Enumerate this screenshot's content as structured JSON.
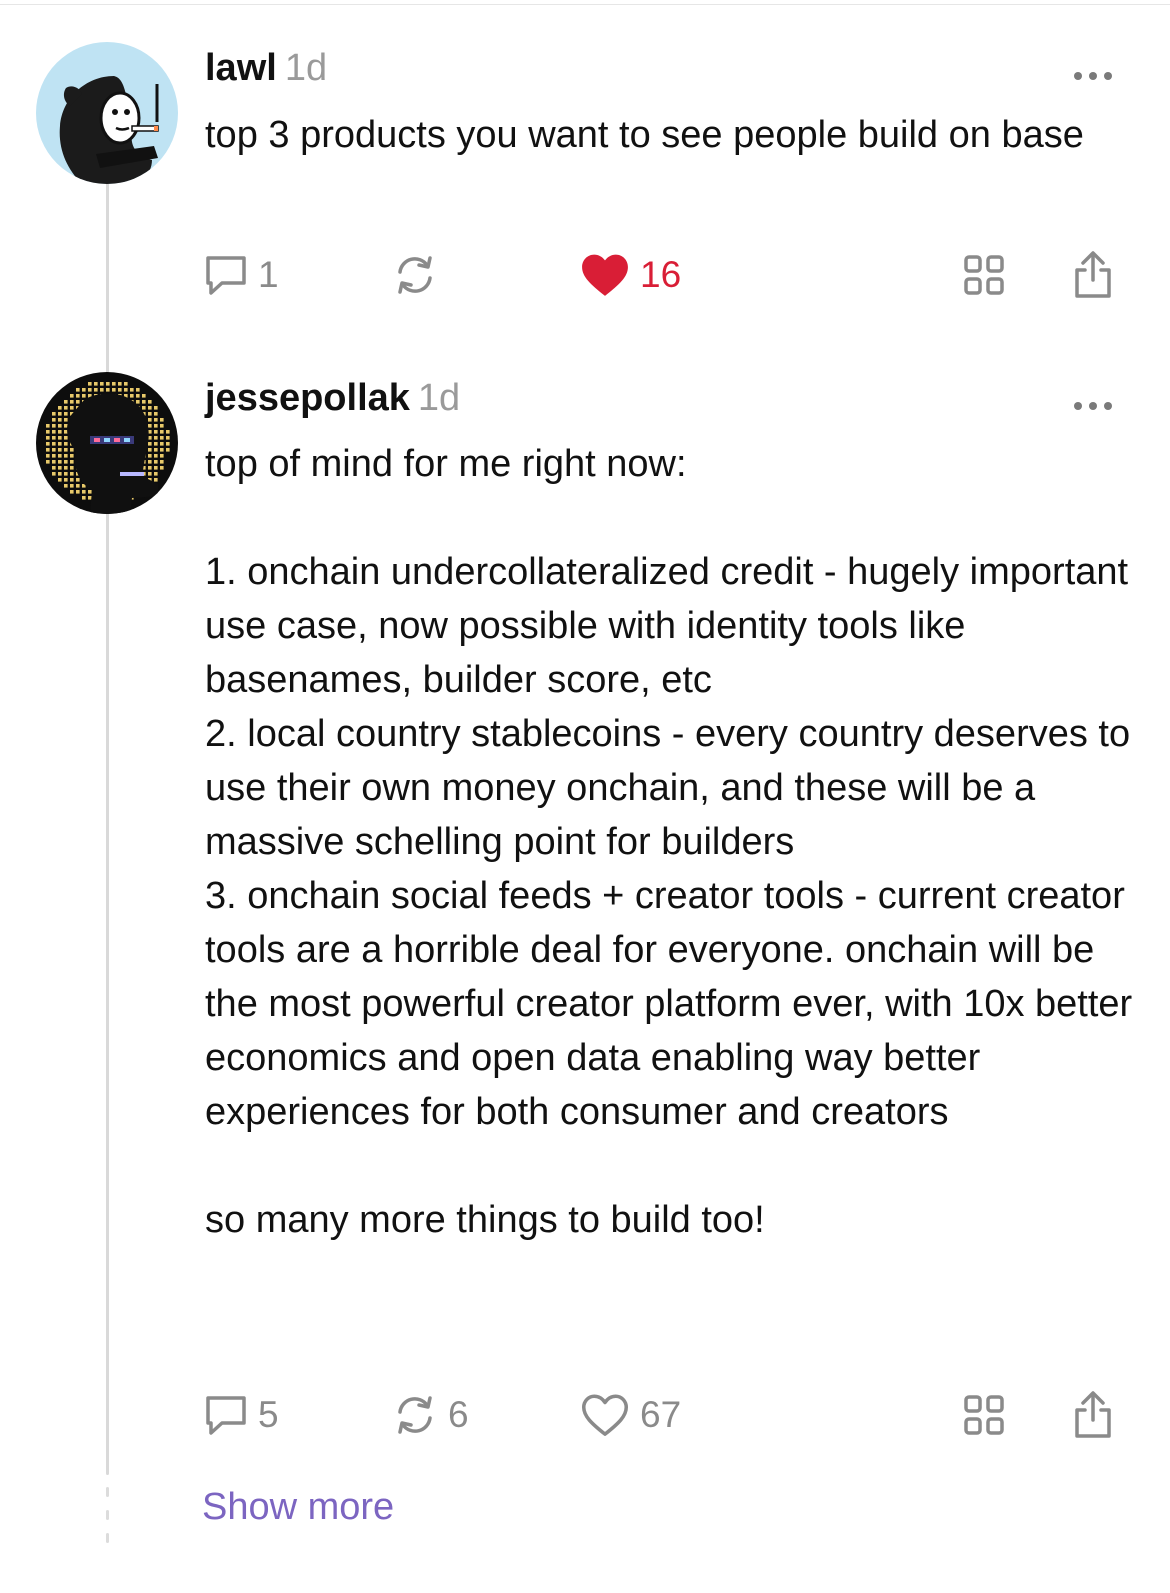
{
  "posts": [
    {
      "username": "lawl",
      "time": "1d",
      "text": "top 3 products you want to see people build on base",
      "avatar_icon": "smoking-hooded-figure-avatar",
      "actions": {
        "replies": "1",
        "recasts": "",
        "likes": "16",
        "liked": true
      }
    },
    {
      "username": "jessepollak",
      "time": "1d",
      "text": "top of mind for me right now:\n\n1. onchain undercollateralized credit - hugely important use case, now possible with identity tools like basenames, builder score, etc\n2. local country stablecoins - every country deserves to use their own money onchain, and these will be a massive schelling point for builders\n3. onchain social feeds + creator tools - current creator tools are a horrible deal for everyone. onchain will be the most powerful creator platform ever, with 10x better economics and open data enabling way better experiences for both consumer and creators\n\nso many more things to build too!",
      "avatar_icon": "pixel-art-avatar",
      "actions": {
        "replies": "5",
        "recasts": "6",
        "likes": "67",
        "liked": false
      }
    }
  ],
  "show_more": "Show more",
  "colors": {
    "like_active": "#d91e36",
    "link": "#7c65c1",
    "muted": "#8a8a8a",
    "thread_line": "#d9d9d9"
  }
}
